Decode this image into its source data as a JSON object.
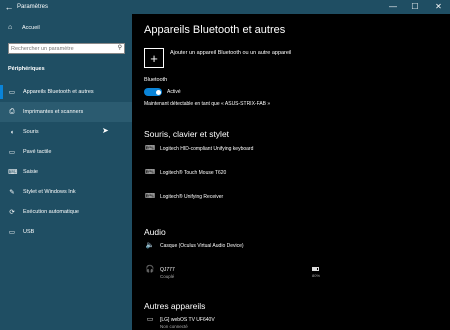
{
  "window": {
    "title": "Paramètres",
    "back_icon": "back-arrow-icon",
    "minimize_glyph": "—",
    "maximize_glyph": "☐",
    "close_glyph": "✕"
  },
  "sidebar": {
    "home_label": "Accueil",
    "search_placeholder": "Rechercher un paramètre",
    "section_title": "Périphériques",
    "items": [
      {
        "label": "Appareils Bluetooth et autres",
        "icon": "bluetooth-device-icon",
        "glyph": "▭"
      },
      {
        "label": "Imprimantes et scanners",
        "icon": "printer-icon",
        "glyph": "⎙"
      },
      {
        "label": "Souris",
        "icon": "mouse-icon",
        "glyph": "◖"
      },
      {
        "label": "Pavé tactile",
        "icon": "touchpad-icon",
        "glyph": "▭"
      },
      {
        "label": "Saisie",
        "icon": "keyboard-icon",
        "glyph": "⌨"
      },
      {
        "label": "Stylet et Windows Ink",
        "icon": "pen-icon",
        "glyph": "✎"
      },
      {
        "label": "Exécution automatique",
        "icon": "autoplay-icon",
        "glyph": "⟳"
      },
      {
        "label": "USB",
        "icon": "usb-icon",
        "glyph": "▭"
      }
    ]
  },
  "main": {
    "title": "Appareils Bluetooth et autres",
    "add_device_label": "Ajouter un appareil Bluetooth ou un autre appareil",
    "bluetooth_label": "Bluetooth",
    "bluetooth_state": "Activé",
    "discoverable_text": "Maintenant détectable en tant que « ASUS-STRIX-FAB »",
    "section_input": "Souris, clavier et stylet",
    "input_devices": [
      {
        "name": "Logitech HID-compliant Unifying keyboard",
        "icon": "keyboard-icon",
        "glyph": "⌨"
      },
      {
        "name": "Logitech® Touch Mouse T620",
        "icon": "keyboard-icon",
        "glyph": "⌨"
      },
      {
        "name": "Logitech® Unifying Receiver",
        "icon": "keyboard-icon",
        "glyph": "⌨"
      }
    ],
    "section_audio": "Audio",
    "audio_devices": [
      {
        "name": "Casque (Oculus Virtual Audio Device)",
        "sub": "",
        "icon": "speaker-icon",
        "glyph": "🔈"
      },
      {
        "name": "QJ777",
        "sub": "Couplé",
        "icon": "headset-icon",
        "glyph": "🎧"
      }
    ],
    "battery_percent": "80%",
    "section_other": "Autres appareils",
    "other_devices": [
      {
        "name": "[LG] webOS TV UF640V",
        "sub": "Non connecté",
        "icon": "tv-icon",
        "glyph": "▭"
      }
    ]
  }
}
